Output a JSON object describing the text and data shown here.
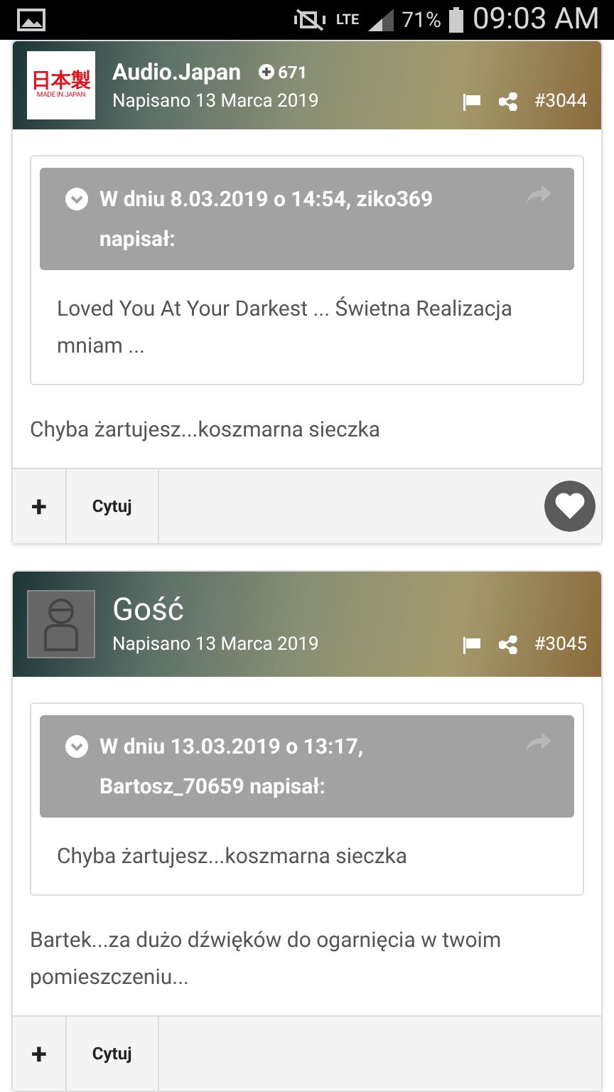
{
  "status_bar": {
    "network": "LTE",
    "battery": "71%",
    "time": "09:03 AM"
  },
  "posts": [
    {
      "author": "Audio.Japan",
      "reputation": "671",
      "avatar": {
        "kind": "logo",
        "text": "日本製",
        "subtext": "MADE IN JAPAN"
      },
      "date": "Napisano 13 Marca 2019",
      "number": "#3044",
      "quote": {
        "header": "W dniu 8.03.2019 o 14:54, ziko369 napisał:",
        "text": "Loved You At Your Darkest ... Świetna Realizacja mniam ..."
      },
      "body": "Chyba żartujesz...koszmarna sieczka",
      "actions": [
        "+",
        "Cytuj"
      ],
      "liked": true
    },
    {
      "author": "Gość",
      "avatar": {
        "kind": "guest"
      },
      "date": "Napisano 13 Marca 2019",
      "number": "#3045",
      "quote": {
        "header": "W dniu 13.03.2019 o 13:17, Bartosz_70659 napisał:",
        "text": "Chyba żartujesz...koszmarna sieczka"
      },
      "body": "Bartek...za dużo dźwięków do ogarnięcia w twoim pomieszczeniu...",
      "actions": [
        "+",
        "Cytuj"
      ],
      "liked": false
    }
  ]
}
